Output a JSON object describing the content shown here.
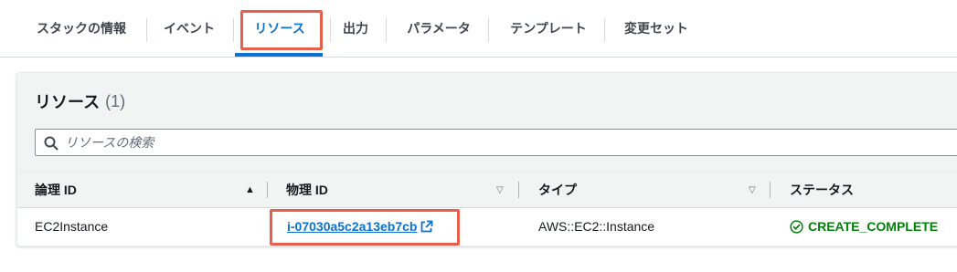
{
  "tabs": [
    {
      "label": "スタックの情報"
    },
    {
      "label": "イベント"
    },
    {
      "label": "リソース"
    },
    {
      "label": "出力"
    },
    {
      "label": "パラメータ"
    },
    {
      "label": "テンプレート"
    },
    {
      "label": "変更セット"
    }
  ],
  "active_tab": "リソース",
  "panel": {
    "title": "リソース",
    "count": "(1)"
  },
  "search": {
    "placeholder": "リソースの検索",
    "value": ""
  },
  "table": {
    "columns": [
      {
        "label": "論理 ID",
        "sort": "ascending"
      },
      {
        "label": "物理 ID",
        "sort": "none"
      },
      {
        "label": "タイプ",
        "sort": "none"
      },
      {
        "label": "ステータス",
        "sort": "none"
      }
    ],
    "rows": [
      {
        "logical_id": "EC2Instance",
        "physical_id": "i-07030a5c2a13eb7cb",
        "type": "AWS::EC2::Instance",
        "status": "CREATE_COMPLETE"
      }
    ]
  },
  "colors": {
    "accent": "#0972d3",
    "success": "#037f0c",
    "highlight": "#e8604c"
  },
  "icons": {
    "search": "search-icon",
    "external_link": "external-link-icon",
    "status": "success-check-icon",
    "sort_asc": "sort-ascending-icon",
    "sort_none": "sort-caret-down-icon"
  }
}
